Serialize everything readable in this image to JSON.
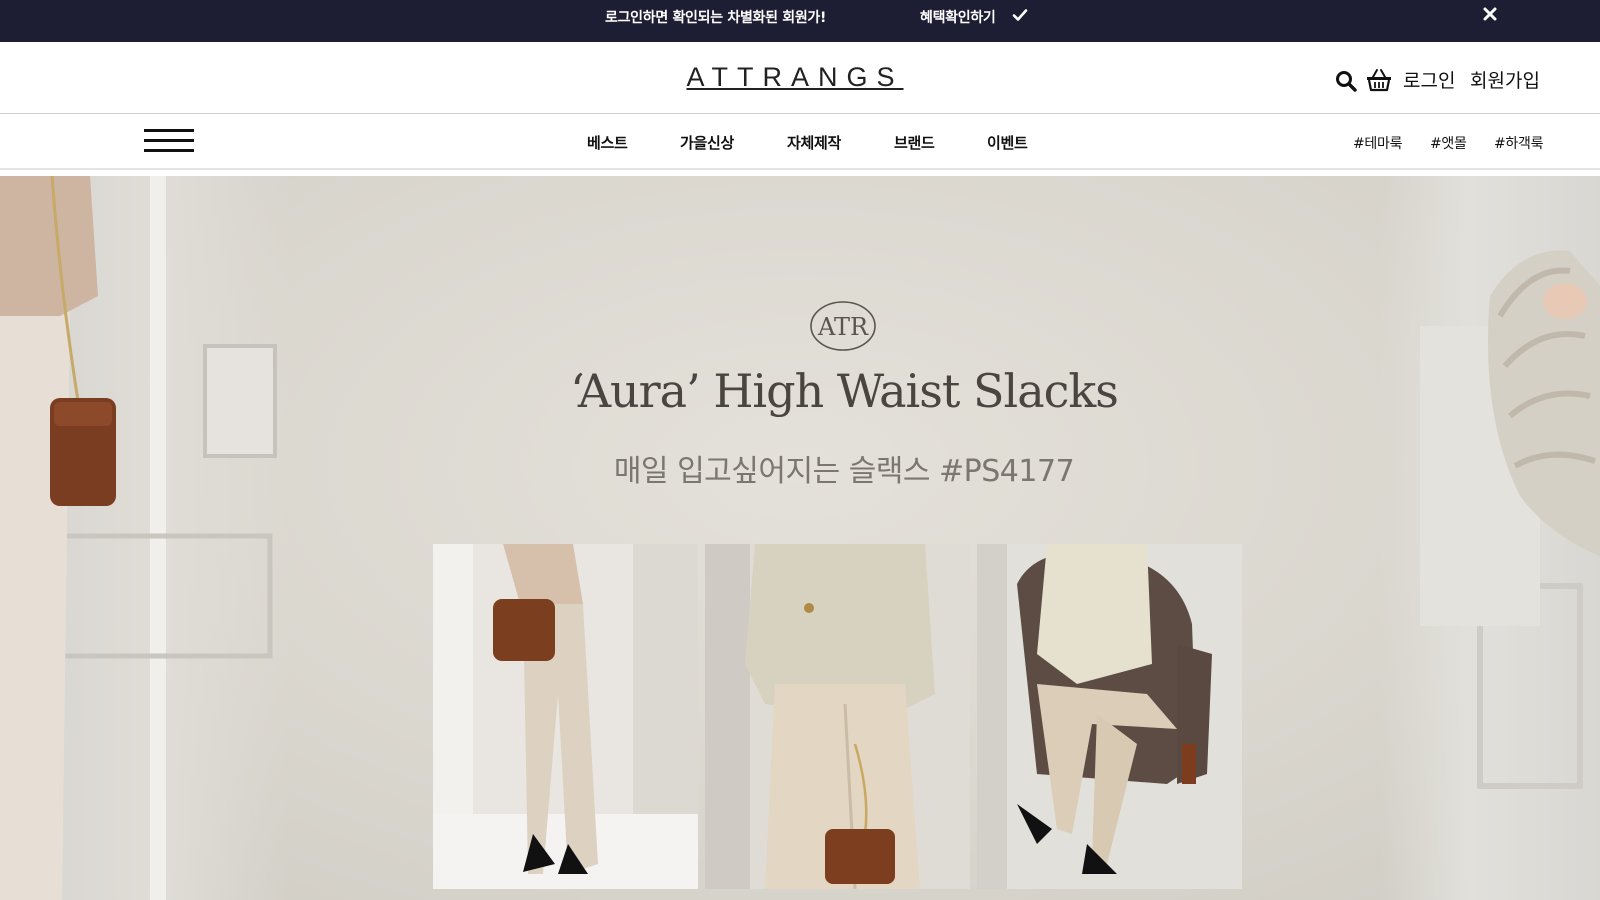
{
  "promo": {
    "text": "로그인하면 확인되는 차별화된 회원가!",
    "link_label": "혜택확인하기",
    "check_icon": "check-icon",
    "close_icon": "close-icon"
  },
  "header": {
    "logo": "ATTRANGS",
    "search_icon": "search-icon",
    "cart_icon": "cart-icon",
    "login_label": "로그인",
    "join_label": "회원가입"
  },
  "nav": {
    "menu_icon": "hamburger-icon",
    "items": [
      {
        "label": "베스트"
      },
      {
        "label": "가을신상"
      },
      {
        "label": "자체제작"
      },
      {
        "label": "브랜드"
      },
      {
        "label": "이벤트"
      }
    ],
    "tags": [
      {
        "label": "#테마룩"
      },
      {
        "label": "#앳몰"
      },
      {
        "label": "#하객룩"
      }
    ]
  },
  "hero": {
    "badge": "ATR",
    "title": "‘Aura’ High Waist Slacks",
    "subtitle": "매일 입고싶어지는 슬랙스 #PS4177",
    "colors": {
      "background": "#dedbd4",
      "title": "#4a4540",
      "subtitle": "#7b7670"
    }
  },
  "colors": {
    "promo_bar": "#1d1d33",
    "text": "#111111"
  }
}
